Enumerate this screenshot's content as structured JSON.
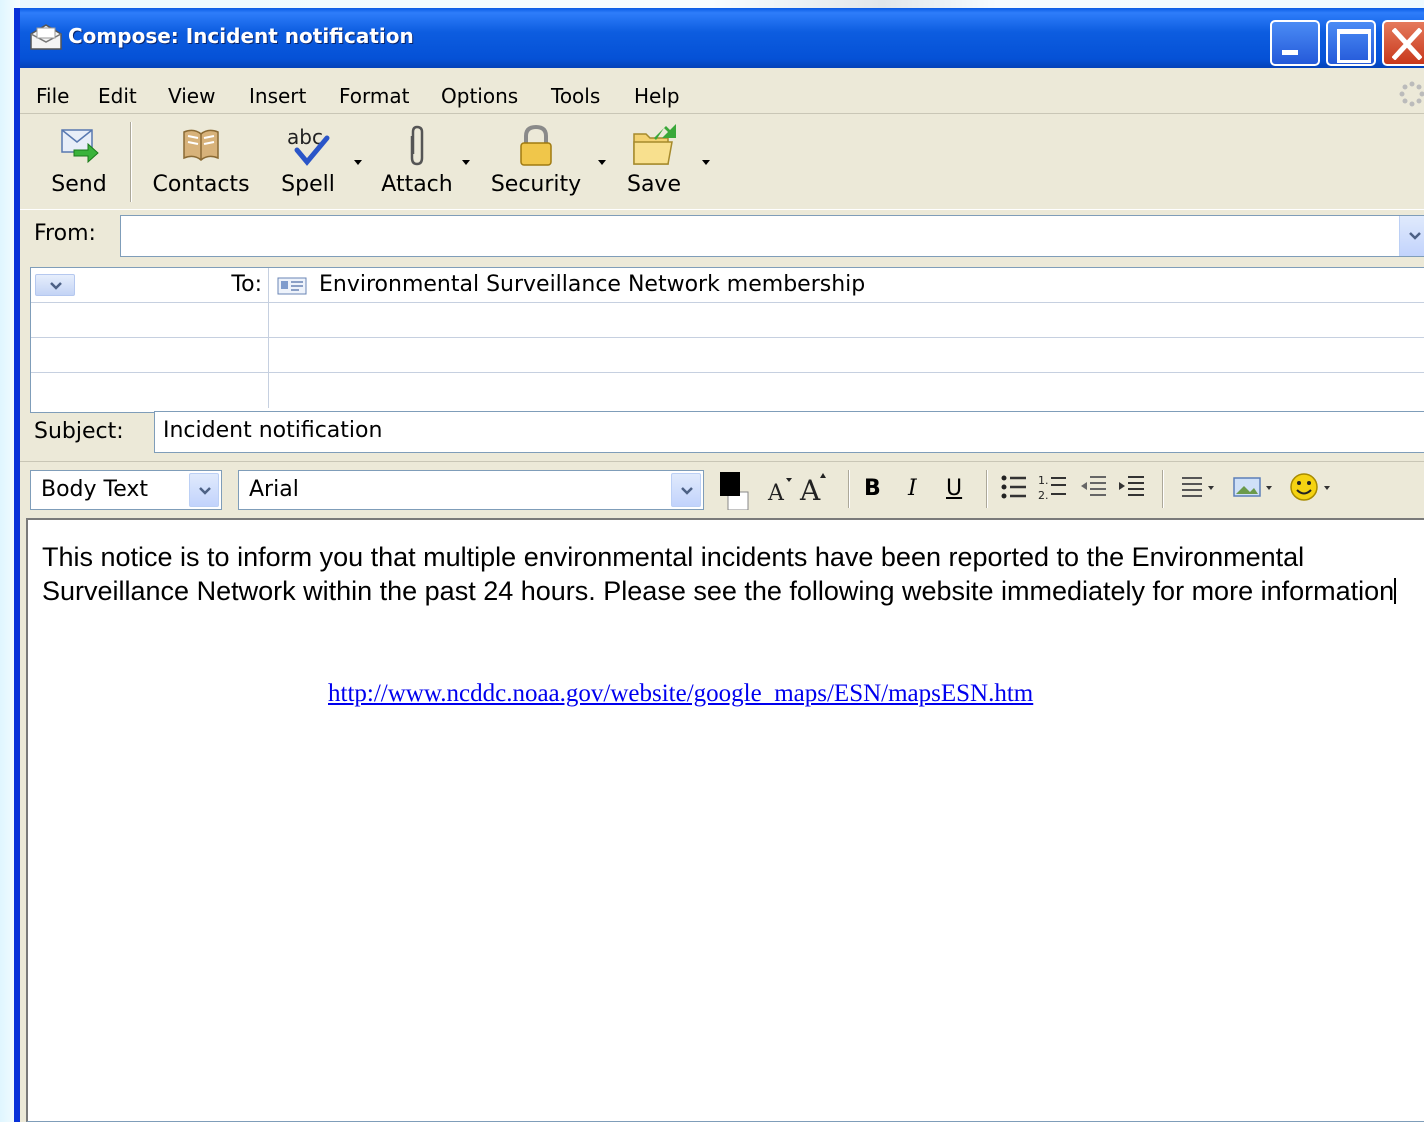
{
  "window": {
    "title": "Compose: Incident notification"
  },
  "menu": [
    "File",
    "Edit",
    "View",
    "Insert",
    "Format",
    "Options",
    "Tools",
    "Help"
  ],
  "toolbar": {
    "send": "Send",
    "contacts": "Contacts",
    "spell": "Spell",
    "attach": "Attach",
    "security": "Security",
    "save": "Save"
  },
  "header": {
    "from_label": "From:",
    "from_value": "",
    "to_label": "To:",
    "to_value": "Environmental Surveillance Network membership",
    "subject_label": "Subject:",
    "subject_value": "Incident notification"
  },
  "format": {
    "paragraph_style": "Body Text",
    "font": "Arial",
    "text_color": "#000000"
  },
  "body": {
    "text": "This notice is to inform you that multiple environmental incidents have been reported to the Environmental Surveillance Network within the past 24 hours. Please see the following website immediately for more information",
    "link": "http://www.ncddc.noaa.gov/website/google_maps/ESN/mapsESN.htm"
  },
  "colors": {
    "titlebar": "#0551d6",
    "chrome": "#ece9d8",
    "link": "#0000ee",
    "close_button": "#c8381c"
  }
}
